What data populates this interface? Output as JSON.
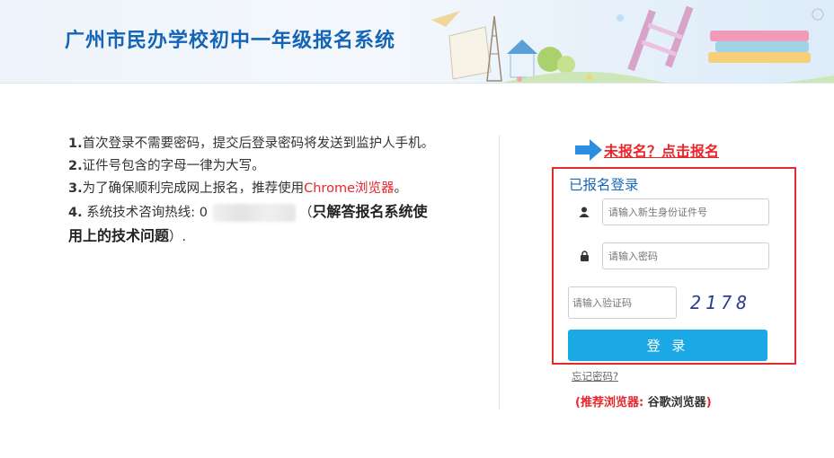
{
  "header": {
    "title": "广州市民办学校初中一年级报名系统"
  },
  "notes": {
    "item1": {
      "num": "1.",
      "text": "首次登录不需要密码，提交后登录密码将发送到监护人手机。"
    },
    "item2": {
      "num": "2.",
      "text": "证件号包含的字母一律为大写。"
    },
    "item3": {
      "num": "3.",
      "text": "为了确保顺利完成网上报名，推荐使用",
      "highlight": "Chrome浏览器",
      "end": "。"
    },
    "item4": {
      "num": "4.",
      "text": " 系统技术咨询热线: 0",
      "paren_open": "（",
      "bold": "只解答报名系统使用上的技术问题",
      "paren_close": "）",
      "end": "."
    }
  },
  "register": {
    "link_label": "未报名？点击报名"
  },
  "login": {
    "title": "已报名登录",
    "id_placeholder": "请输入新生身份证件号",
    "password_placeholder": "请输入密码",
    "captcha_placeholder": "请输入验证码",
    "captcha_code": "2178",
    "submit_label": "登 录",
    "forgot_label": "忘记密码?"
  },
  "tip": {
    "open": "(推荐浏览器: ",
    "browser": "谷歌浏览器",
    "close": ")"
  },
  "colors": {
    "brand_blue": "#1565b6",
    "button_blue": "#1ba9e6",
    "alert_red": "#e8262b",
    "box_border": "#e22c2c"
  },
  "icons": {
    "user": "user-icon",
    "lock": "lock-icon",
    "arrow": "arrow-right-icon"
  }
}
